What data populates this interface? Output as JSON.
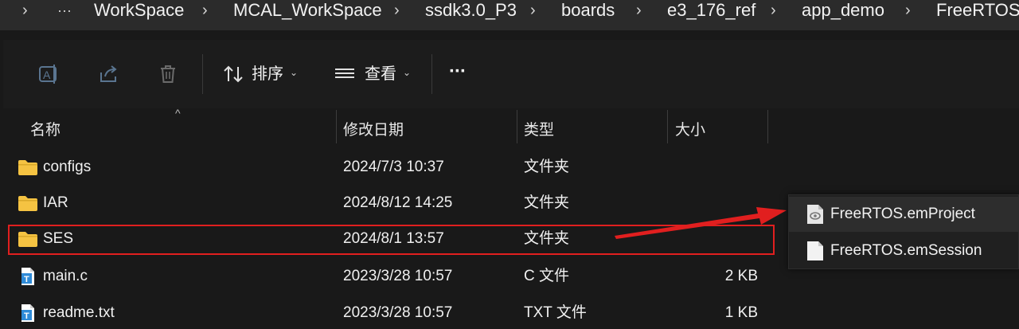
{
  "breadcrumb": {
    "chevron": "›",
    "overflow": "···",
    "items": [
      "WorkSpace",
      "MCAL_WorkSpace",
      "ssdk3.0_P3",
      "boards",
      "e3_176_ref",
      "app_demo",
      "FreeRTOS"
    ]
  },
  "toolbar": {
    "rename_icon": "rename-icon",
    "share_icon": "share-icon",
    "delete_icon": "trash-icon",
    "sort_label": "排序",
    "view_label": "查看",
    "more_label": "···"
  },
  "columns": {
    "name": "名称",
    "date": "修改日期",
    "type": "类型",
    "size": "大小"
  },
  "files": [
    {
      "name": "configs",
      "date": "2024/7/3 10:37",
      "type": "文件夹",
      "size": "",
      "icon": "folder-icon"
    },
    {
      "name": "IAR",
      "date": "2024/8/12 14:25",
      "type": "文件夹",
      "size": "",
      "icon": "folder-icon"
    },
    {
      "name": "SES",
      "date": "2024/8/1 13:57",
      "type": "文件夹",
      "size": "",
      "icon": "folder-icon"
    },
    {
      "name": "main.c",
      "date": "2023/3/28 10:57",
      "type": "C 文件",
      "size": "2 KB",
      "icon": "text-file-icon"
    },
    {
      "name": "readme.txt",
      "date": "2023/3/28 10:57",
      "type": "TXT 文件",
      "size": "1 KB",
      "icon": "text-file-icon"
    }
  ],
  "popup": {
    "items": [
      {
        "label": "FreeRTOS.emProject",
        "icon": "emproject-icon"
      },
      {
        "label": "FreeRTOS.emSession",
        "icon": "document-icon"
      }
    ]
  },
  "colors": {
    "highlight": "#e11f1f",
    "folder": "#f5c342",
    "text_file": "#2f8bd8"
  }
}
